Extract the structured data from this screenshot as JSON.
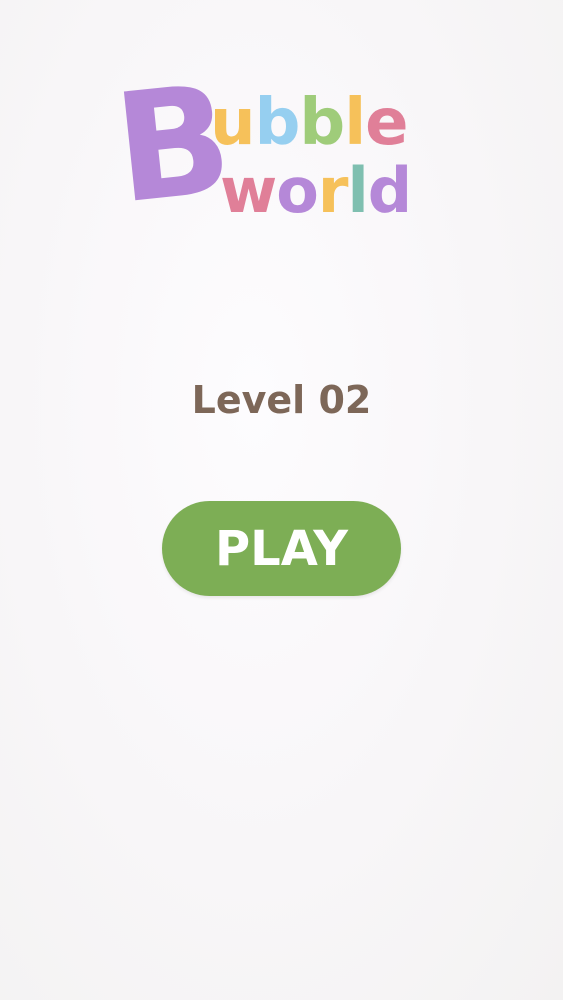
{
  "logo": {
    "big_letter": {
      "char": "B",
      "color": "#b588d8"
    },
    "top_row": [
      {
        "char": "u",
        "color": "#f6c15a"
      },
      {
        "char": "b",
        "color": "#96cff0"
      },
      {
        "char": "b",
        "color": "#9fcc7a"
      },
      {
        "char": "l",
        "color": "#f6c15a"
      },
      {
        "char": "e",
        "color": "#e07f98"
      }
    ],
    "bottom_row": [
      {
        "char": "w",
        "color": "#e07f98"
      },
      {
        "char": "o",
        "color": "#b588d8"
      },
      {
        "char": "r",
        "color": "#f6c15a"
      },
      {
        "char": "l",
        "color": "#7fbfb0"
      },
      {
        "char": "d",
        "color": "#b588d8"
      }
    ]
  },
  "level": {
    "label": "Level 02"
  },
  "play_button": {
    "label": "PLAY",
    "color": "#7dae55"
  }
}
